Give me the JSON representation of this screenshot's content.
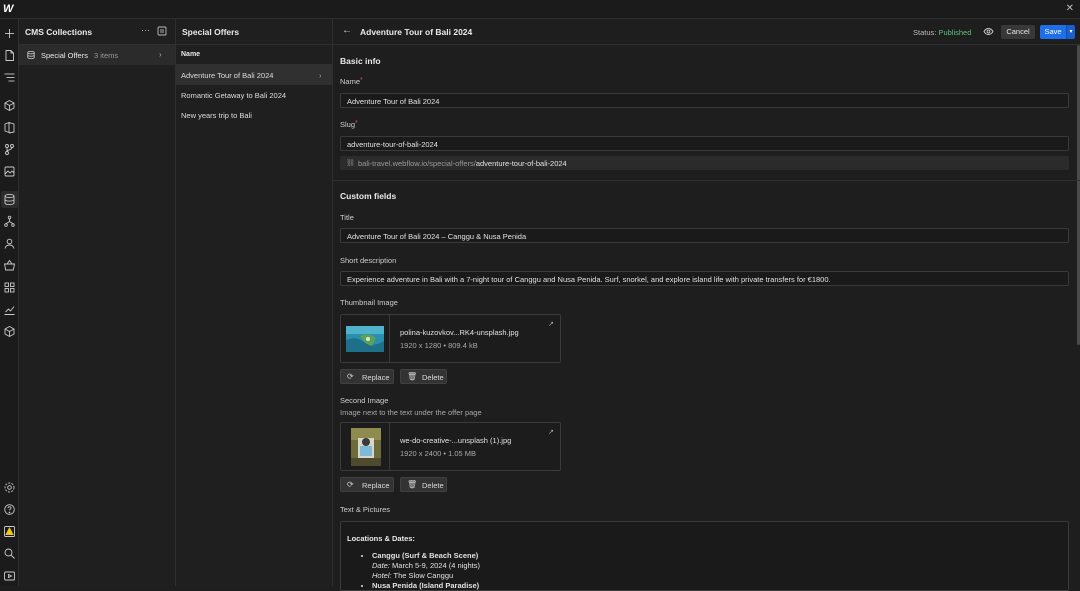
{
  "colors": {
    "accent": "#1f6feb",
    "published": "#5fc27b",
    "required": "#e05252"
  },
  "sidebar_icons": [
    "add-icon",
    "pages-icon",
    "navigator-icon",
    "components-icon",
    "style-selectors-icon",
    "variables-icon",
    "assets-icon",
    "cms-icon",
    "logic-icon",
    "users-icon",
    "ecommerce-icon",
    "apps-icon",
    "analyze-icon",
    "packages-icon",
    "settings-icon",
    "help-icon",
    "audit-warning-icon",
    "search-icon",
    "video-tutorials-icon"
  ],
  "collections": {
    "title": "CMS Collections",
    "items": [
      {
        "name": "Special Offers",
        "count": "3 items"
      }
    ]
  },
  "items_panel": {
    "title": "Special Offers",
    "column": "Name",
    "rows": [
      "Adventure Tour of Bali 2024",
      "Romantic Getaway to Bali 2024",
      "New years trip to Bali"
    ]
  },
  "editor": {
    "title": "Adventure Tour of Bali 2024",
    "status_label": "Status:",
    "status_value": "Published",
    "cancel": "Cancel",
    "save": "Save",
    "basic_info": "Basic info",
    "name_label": "Name",
    "name_value": "Adventure Tour of Bali 2024",
    "slug_label": "Slug",
    "slug_value": "adventure-tour-of-bali-2024",
    "url_prefix": "bali-travel.webflow.io/special-offers/",
    "url_slug": "adventure-tour-of-bali-2024",
    "custom_fields": "Custom fields",
    "title_label": "Title",
    "title_value": "Adventure Tour of Bali 2024 – Canggu & Nusa Penida",
    "short_desc_label": "Short description",
    "short_desc_value": "Experience adventure in Bali with a 7-night tour of Canggu and Nusa Penida. Surf, snorkel, and explore island life with private transfers for €1800.",
    "thumb_label": "Thumbnail Image",
    "thumb_file": "polina-kuzovkov...RK4-unsplash.jpg",
    "thumb_dims": "1920 x 1280",
    "thumb_size": "809.4 kB",
    "replace": "Replace",
    "delete": "Delete",
    "second_label": "Second Image",
    "second_help": "Image next to the text under the offer page",
    "second_file": "we-do-creative-...unsplash (1).jpg",
    "second_dims": "1920 x 2400",
    "second_size": "1.05 MB",
    "rich_label": "Text & Pictures",
    "rich_heading": "Locations & Dates:",
    "loc1_name": "Canggu (Surf & Beach Scene)",
    "loc1_date_label": "Date:",
    "loc1_date": "March 5-9, 2024 (4 nights)",
    "loc1_hotel_label": "Hotel:",
    "loc1_hotel": "The Slow Canggu",
    "loc2_name": "Nusa Penida (Island Paradise)"
  }
}
